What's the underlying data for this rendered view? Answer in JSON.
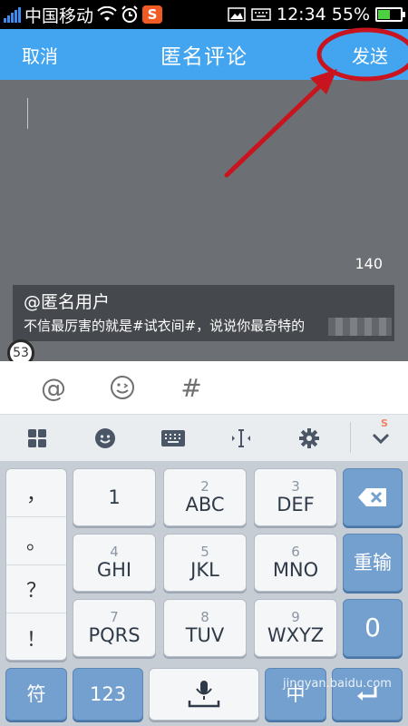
{
  "status_bar": {
    "carrier": "中国移动",
    "time": "12:34",
    "battery": "55%",
    "battery_level": 0.55,
    "sogou_label": "S",
    "icons": [
      "signal-icon",
      "wifi-icon",
      "alarm-icon",
      "sogou-icon",
      "image-icon",
      "keyboard-icon",
      "battery-icon"
    ]
  },
  "header": {
    "cancel": "取消",
    "title": "匿名评论",
    "send": "发送",
    "bg_color": "#43a4f0"
  },
  "compose": {
    "counter": "140",
    "quote_user": "@匿名用户",
    "quote_text": "不信最厉害的就是#试衣间#，说说你最奇特的",
    "badge": "53"
  },
  "tools": [
    {
      "icon": "at-icon",
      "label": "@"
    },
    {
      "icon": "emoji-icon",
      "label": "☺"
    },
    {
      "icon": "hashtag-icon",
      "label": "#"
    }
  ],
  "ime_toolbar": [
    "grid-icon",
    "smiley-icon",
    "keyboard-icon",
    "cursor-icon",
    "gear-icon",
    "chevron-down-icon"
  ],
  "keyboard": {
    "punct": [
      "，",
      "。",
      "？",
      "！"
    ],
    "row1": [
      {
        "num": "",
        "label": "1"
      },
      {
        "num": "2",
        "label": "ABC"
      },
      {
        "num": "3",
        "label": "DEF"
      }
    ],
    "row2": [
      {
        "num": "4",
        "label": "GHI"
      },
      {
        "num": "5",
        "label": "JKL"
      },
      {
        "num": "6",
        "label": "MNO"
      }
    ],
    "row3": [
      {
        "num": "7",
        "label": "PQRS"
      },
      {
        "num": "8",
        "label": "TUV"
      },
      {
        "num": "9",
        "label": "WXYZ"
      }
    ],
    "backspace_icon": "backspace-icon",
    "reenter": "重输",
    "zero": "0",
    "symbol": "符",
    "num123": "123",
    "space_icon": "microphone-icon",
    "lang": "中",
    "enter_icon": "enter-icon"
  },
  "watermark": "jingyan.baidu.com"
}
